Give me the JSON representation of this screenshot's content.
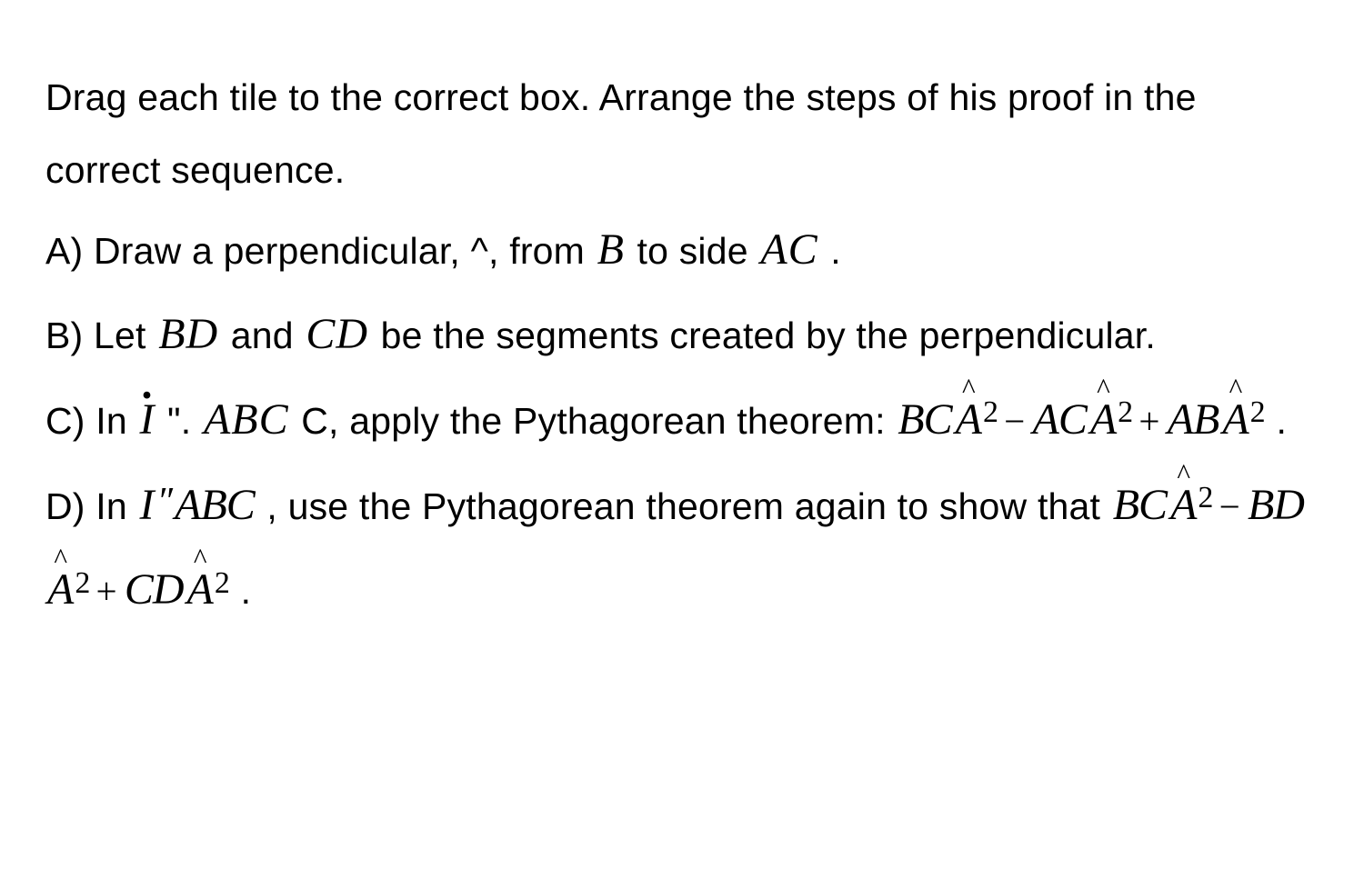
{
  "intro": "Drag each tile to the correct box. Arrange the steps of his proof in the correct sequence.",
  "A": {
    "prefix": "A) Draw a perpendicular, ^, from ",
    "var1": "B",
    "mid": " to side ",
    "var2": "AC",
    "suffix": " ."
  },
  "B": {
    "prefix": "B) Let ",
    "var1": "BD",
    "mid": " and ",
    "var2": "CD",
    "suffix": " be the segments created by the perpendicular."
  },
  "C": {
    "prefix": "C) In ",
    "I": "I",
    "afterI": " \". ",
    "tri": "ABC",
    "afterTri": " C, apply the Pythagorean theorem: ",
    "t1a": "BC",
    "t1h": "A",
    "t1s": "2",
    "minus": "−",
    "t2a": "AC",
    "t2h": "A",
    "t2s": "2",
    "plus": "+",
    "t3a": "AB",
    "t3h": "A",
    "t3s": "2",
    "suffix": " ."
  },
  "D": {
    "prefix": "D) In ",
    "I": "I",
    "pp": "″",
    "tri": "ABC",
    "afterTri": "  , use the Pythagorean theorem again to show that ",
    "t1a": "BC",
    "t1h": "A",
    "t1s": "2",
    "minus": "−",
    "t2a": "BD",
    "t2h": "A",
    "t2s": "2",
    "plus": "+",
    "t3a": "CD",
    "t3h": "A",
    "t3s": "2",
    "suffix": " ."
  }
}
